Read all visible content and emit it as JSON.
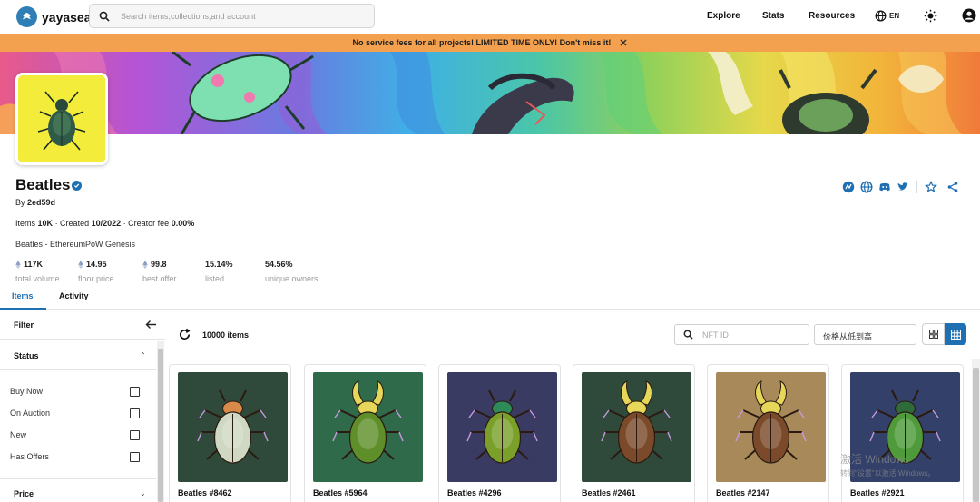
{
  "nav": {
    "brand": "yayasea",
    "search_placeholder": "Search items,collections,and account",
    "links": [
      "Explore",
      "Stats",
      "Resources"
    ],
    "language": "EN"
  },
  "promo": {
    "text": "No service fees for all projects! LIMITED TIME ONLY! Don't miss it!",
    "close": "✕"
  },
  "collection": {
    "name": "Beatles",
    "by_label": "By",
    "creator": "2ed59d",
    "items_label": "Items",
    "items_value": "10K",
    "created_label": "· Created",
    "created_value": "10/2022",
    "fee_label": "· Creator fee",
    "fee_value": "0.00%",
    "description": "Beatles - EthereumPoW Genesis",
    "stats": [
      {
        "value": "117K",
        "label": "total volume",
        "eth": true
      },
      {
        "value": "14.95",
        "label": "floor price",
        "eth": true
      },
      {
        "value": "99.8",
        "label": "best offer",
        "eth": true
      },
      {
        "value": "15.14%",
        "label": "listed",
        "eth": false
      },
      {
        "value": "54.56%",
        "label": "unique owners",
        "eth": false
      }
    ]
  },
  "tabs": {
    "items": "Items",
    "activity": "Activity"
  },
  "sidebar": {
    "filter": "Filter",
    "status": "Status",
    "status_options": [
      "Buy Now",
      "On Auction",
      "New",
      "Has Offers"
    ],
    "price": "Price"
  },
  "toolbar": {
    "count": "10000 items",
    "nft_placeholder": "NFT ID",
    "sort": "价格从低到高"
  },
  "cards": [
    {
      "name": "Beatles #8462",
      "bg": "#2f4a3b",
      "body": "#cfd8c2",
      "accent": "#d88a4a",
      "horns": false
    },
    {
      "name": "Beatles #5964",
      "bg": "#2f6a4a",
      "body": "#5f8f2a",
      "accent": "#e6d75a",
      "horns": true
    },
    {
      "name": "Beatles #4296",
      "bg": "#3a3b63",
      "body": "#7ba02a",
      "accent": "#2f8a5a",
      "horns": false
    },
    {
      "name": "Beatles #2461",
      "bg": "#2f4a3b",
      "body": "#7a4a2a",
      "accent": "#e6d75a",
      "horns": true
    },
    {
      "name": "Beatles #2147",
      "bg": "#a88a5a",
      "body": "#7a4a2a",
      "accent": "#e6d75a",
      "horns": true
    },
    {
      "name": "Beatles #2921",
      "bg": "#32406a",
      "body": "#4f9a3a",
      "accent": "#2f6a3a",
      "horns": false
    }
  ],
  "watermark": {
    "line1": "激活 Windows",
    "line2": "转到\"设置\"以激活 Windows。"
  },
  "colors": {
    "accent": "#1f6fb3",
    "promo": "#f3a14f",
    "avatar_bg": "#f3ec3a"
  }
}
